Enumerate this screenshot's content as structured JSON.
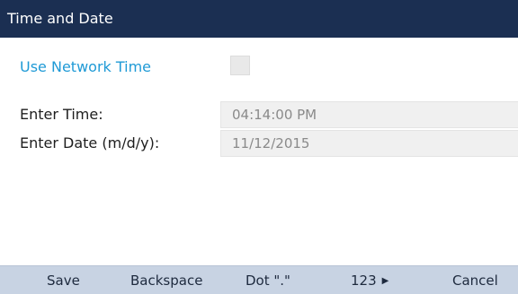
{
  "header": {
    "title": "Time and Date"
  },
  "settings": {
    "use_network_time_label": "Use Network Time",
    "use_network_time_checked": false,
    "time_label": "Enter Time:",
    "time_value": "04:14:00 PM",
    "date_label": "Enter Date (m/d/y):",
    "date_value": "11/12/2015"
  },
  "softkeys": {
    "save": "Save",
    "backspace": "Backspace",
    "dot": "Dot \".\"",
    "mode": "123",
    "mode_arrow": "▶",
    "cancel": "Cancel"
  },
  "colors": {
    "title_bar": "#1b2f52",
    "highlight_text": "#1f9ad6",
    "softkey_bar": "#c8d3e3"
  }
}
